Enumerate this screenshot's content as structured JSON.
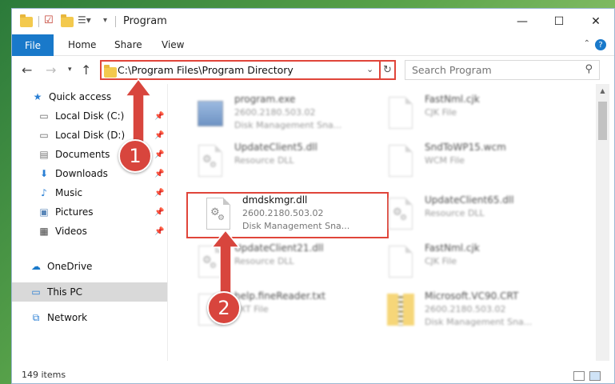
{
  "window": {
    "title": "Program",
    "minimize_glyph": "—",
    "maximize_glyph": "☐",
    "close_glyph": "✕"
  },
  "ribbon": {
    "file": "File",
    "tabs": [
      "Home",
      "Share",
      "View"
    ],
    "help_glyph": "?"
  },
  "nav": {
    "address": "C:\\Program Files\\Program Directory",
    "search_placeholder": "Search Program"
  },
  "sidebar": {
    "items": [
      {
        "label": "Quick access",
        "icon": "star-icon"
      },
      {
        "label": "Local Disk (C:)",
        "icon": "drive-icon",
        "pinned": true
      },
      {
        "label": "Local Disk (D:)",
        "icon": "drive-icon",
        "pinned": true
      },
      {
        "label": "Documents",
        "icon": "documents-icon",
        "pinned": true
      },
      {
        "label": "Downloads",
        "icon": "download-arrow-icon",
        "pinned": true
      },
      {
        "label": "Music",
        "icon": "music-note-icon",
        "pinned": true
      },
      {
        "label": "Pictures",
        "icon": "pictures-icon",
        "pinned": true
      },
      {
        "label": "Videos",
        "icon": "film-icon",
        "pinned": true
      },
      {
        "label": "OneDrive",
        "icon": "cloud-icon"
      },
      {
        "label": "This PC",
        "icon": "monitor-icon",
        "selected": true
      },
      {
        "label": "Network",
        "icon": "network-icon"
      }
    ]
  },
  "files": {
    "items": [
      {
        "name": "program.exe",
        "line2": "2600.2180.503.02",
        "line3": "Disk Management Sna...",
        "icon": "exe-icon",
        "blurred": true
      },
      {
        "name": "FastNml.cjk",
        "line2": "CJK File",
        "line3": "",
        "icon": "document-icon",
        "blurred": true
      },
      {
        "name": "UpdateClient5.dll",
        "line2": "Resource DLL",
        "line3": "",
        "icon": "dll-gear-icon",
        "blurred": true
      },
      {
        "name": "SndToWP15.wcm",
        "line2": "WCM File",
        "line3": "",
        "icon": "document-icon",
        "blurred": true
      },
      {
        "name": "dmdskmgr.dll",
        "line2": "2600.2180.503.02",
        "line3": "Disk Management Sna...",
        "icon": "dll-gear-icon",
        "blurred": false
      },
      {
        "name": "UpdateClient65.dll",
        "line2": "Resource DLL",
        "line3": "",
        "icon": "dll-gear-icon",
        "blurred": true
      },
      {
        "name": "UpdateClient21.dll",
        "line2": "Resource DLL",
        "line3": "",
        "icon": "dll-gear-icon",
        "blurred": true
      },
      {
        "name": "FastNml.cjk",
        "line2": "CJK File",
        "line3": "",
        "icon": "document-icon",
        "blurred": true
      },
      {
        "name": "help.fineReader.txt",
        "line2": "TXT File",
        "line3": "",
        "icon": "document-icon",
        "blurred": true
      },
      {
        "name": "Microsoft.VC90.CRT",
        "line2": "2600.2180.503.02",
        "line3": "Disk Management Sna...",
        "icon": "zip-folder-icon",
        "blurred": true
      }
    ]
  },
  "status": {
    "count": "149 items"
  },
  "markers": [
    "1",
    "2"
  ],
  "colors": {
    "accent": "#1979ca",
    "highlight": "#e0453a",
    "marker": "#d8453d"
  }
}
